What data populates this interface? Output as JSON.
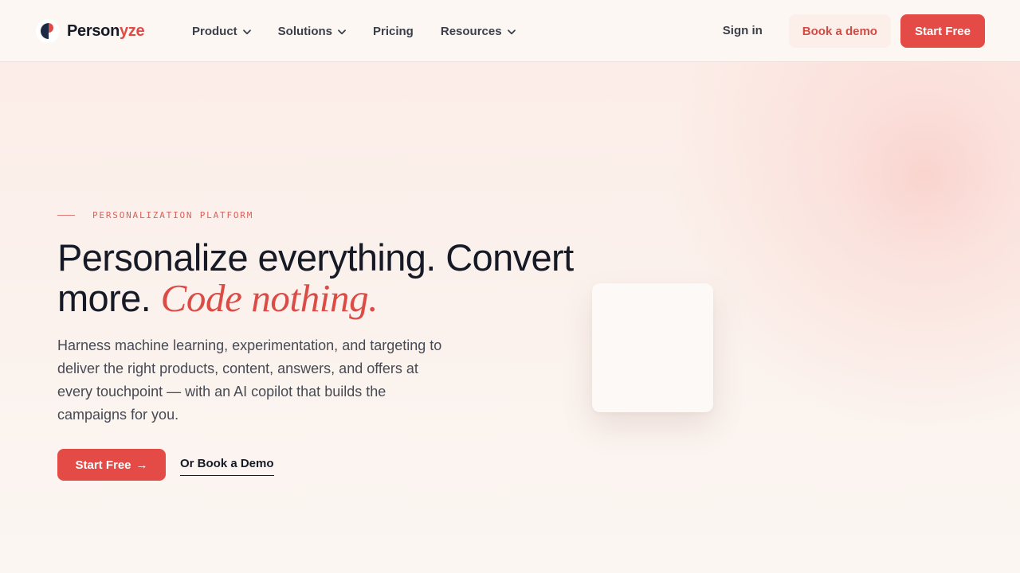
{
  "header": {
    "logo": {
      "text_main": "Person",
      "text_accent": "yze",
      "icon": "personyze-logo-icon"
    },
    "nav": [
      {
        "label": "Product",
        "has_dropdown": true
      },
      {
        "label": "Solutions",
        "has_dropdown": true
      },
      {
        "label": "Pricing",
        "has_dropdown": false
      },
      {
        "label": "Resources",
        "has_dropdown": true
      }
    ],
    "sign_in_label": "Sign in",
    "book_demo_label": "Book a demo",
    "start_free_label": "Start Free"
  },
  "hero": {
    "eyebrow": "PERSONALIZATION PLATFORM",
    "headline_plain": "Personalize everything. Convert more.",
    "headline_italic": "Code nothing.",
    "subtext": "Harness machine learning, experimentation, and targeting to deliver the right products, content, answers, and offers at every touchpoint — with an AI copilot that builds the campaigns for you.",
    "cta_primary": "Start Free",
    "cta_primary_icon": "arrow-right-icon",
    "cta_secondary": "Or Book a Demo"
  },
  "colors": {
    "accent": "#e54b46",
    "text": "#161a26",
    "background": "#fbf5f1"
  }
}
